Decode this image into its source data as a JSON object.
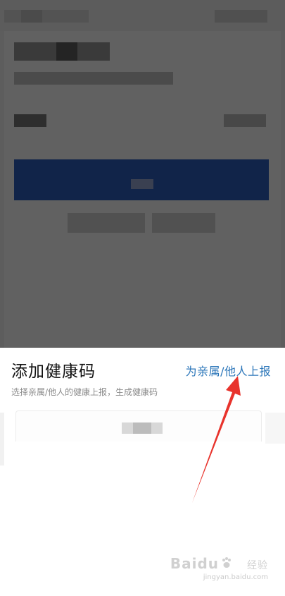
{
  "sheet": {
    "title": "添加健康码",
    "family_report_link": "为亲属/他人上报",
    "subtitle": "选择亲属/他人的健康上报，生成健康码"
  },
  "watermark": {
    "brand": "Baidu",
    "suffix": "经验",
    "site": "jingyan.baidu.com"
  },
  "colors": {
    "link": "#2b76b9",
    "primary_button": "#2f5fbf",
    "annotation_arrow": "#e8332c",
    "overlay": "rgba(0,0,0,0.62)"
  },
  "icons": {
    "annotation": "red-arrow-icon",
    "watermark_logo": "baidu-paw-icon"
  }
}
